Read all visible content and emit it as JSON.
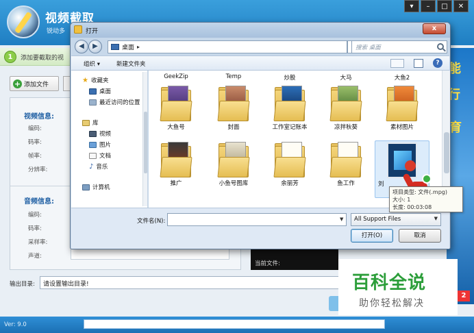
{
  "app": {
    "title": "视频截取",
    "subtitle": "锐动多",
    "step_number": "1",
    "step_text": "添加要截取的视",
    "add_file_label": "添加文件",
    "video_info_title": "视频信息:",
    "video_fields": [
      "编码:",
      "码率:",
      "帧率:",
      "分辨率:"
    ],
    "audio_info_title": "音频信息:",
    "audio_fields": [
      "编码:",
      "码率:",
      "采样率:",
      "声道:"
    ],
    "current_file_label": "当前文件:",
    "output_label": "输出目录:",
    "output_value": "请设置输出目录!",
    "version": "Ver: 9.0",
    "ad_chars": [
      "能",
      "行",
      "育"
    ],
    "ad_page": "2"
  },
  "dialog": {
    "title": "打开",
    "close_label": "x",
    "address": "桌面",
    "search_placeholder": "搜索 桌面",
    "toolbar": {
      "organize": "组织 ▾",
      "new_folder": "新建文件夹",
      "help": "?"
    },
    "nav": {
      "favorites": "收藏夹",
      "desktop": "桌面",
      "recent": "最近访问的位置",
      "libraries": "库",
      "videos": "视频",
      "pictures": "图片",
      "documents": "文档",
      "music": "音乐",
      "computer": "计算机"
    },
    "top_row": [
      "GeekZip",
      "Temp",
      "炒股",
      "大马",
      "大鱼2"
    ],
    "row1": [
      "大鱼号",
      "封面",
      "工作室记账本",
      "凉拌秋葵",
      "素材图片"
    ],
    "row2": [
      "推广",
      "小鱼号图库",
      "余丽芳",
      "鱼工作",
      "刘"
    ],
    "tooltip": {
      "line1": "项目类型: 文件(.mpg)",
      "line2": "大小: 1",
      "line3": "长度: 00:03:08"
    },
    "filename_label": "文件名(N):",
    "filename_value": "",
    "filter": "All Support Files",
    "open_button": "打开(O)",
    "cancel_button": "取消"
  },
  "watermark": {
    "big": "百科全说",
    "small": "助你轻松解决"
  },
  "colors": {
    "header": "#2a8ed0",
    "accent_green": "#2c9e3a",
    "footer": "#1f7ec2"
  }
}
